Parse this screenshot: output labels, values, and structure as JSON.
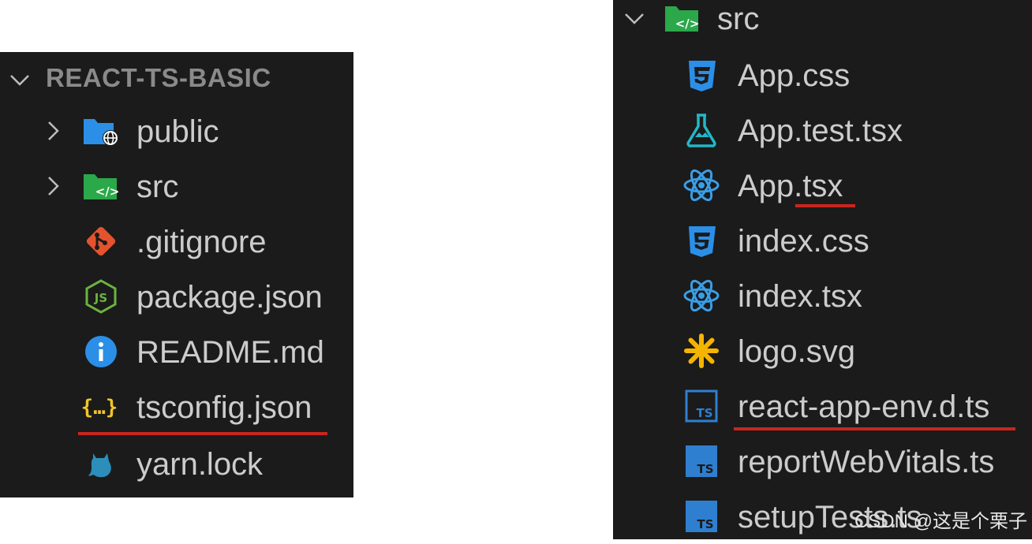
{
  "left_explorer": {
    "root_label": "REACT-TS-BASIC",
    "items": [
      {
        "label": "public",
        "icon": "public-folder-icon"
      },
      {
        "label": "src",
        "icon": "src-folder-icon"
      },
      {
        "label": ".gitignore",
        "icon": "git-icon"
      },
      {
        "label": "package.json",
        "icon": "nodejs-icon"
      },
      {
        "label": "README.md",
        "icon": "info-icon"
      },
      {
        "label": "tsconfig.json",
        "icon": "json-braces-icon"
      },
      {
        "label": "yarn.lock",
        "icon": "yarn-cat-icon"
      }
    ]
  },
  "right_explorer": {
    "folder_label": "src",
    "items": [
      {
        "label": "App.css",
        "icon": "css-icon"
      },
      {
        "label": "App.test.tsx",
        "icon": "test-flask-icon"
      },
      {
        "label": "App.tsx",
        "icon": "react-icon"
      },
      {
        "label": "index.css",
        "icon": "css-icon"
      },
      {
        "label": "index.tsx",
        "icon": "react-icon"
      },
      {
        "label": "logo.svg",
        "icon": "svg-asterisk-icon"
      },
      {
        "label": "react-app-env.d.ts",
        "icon": "ts-outline-icon"
      },
      {
        "label": "reportWebVitals.ts",
        "icon": "ts-icon"
      },
      {
        "label": "setupTests.ts",
        "icon": "ts-icon"
      }
    ]
  },
  "watermark": "CSDN @这是个栗子",
  "colors": {
    "panel_bg": "#1b1b1b",
    "text": "#cccccc",
    "underline": "#c8261e",
    "folder_green": "#2aa84a",
    "folder_blue": "#2b8fe8",
    "react_blue": "#3a9ee6",
    "ts_blue": "#2f7fd0",
    "json_yellow": "#f0c52a",
    "git_orange": "#e4532d"
  }
}
